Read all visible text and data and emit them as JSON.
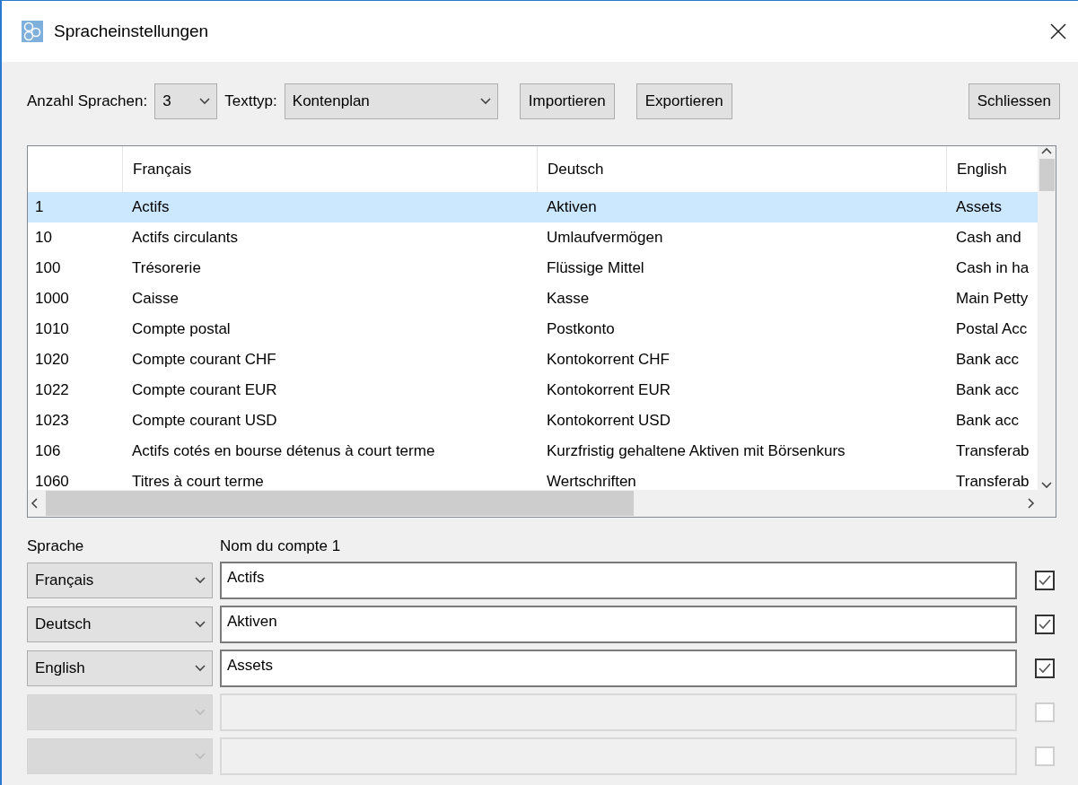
{
  "window": {
    "title": "Spracheinstellungen"
  },
  "toolbar": {
    "count_label": "Anzahl Sprachen:",
    "count_value": "3",
    "type_label": "Texttyp:",
    "type_value": "Kontenplan",
    "buttons": [
      "Importieren",
      "Exportieren"
    ],
    "close_button": "Schliessen"
  },
  "table": {
    "columns": [
      "Français",
      "Deutsch",
      "English"
    ],
    "rows": [
      {
        "number": "1",
        "fr": "Actifs",
        "de": "Aktiven",
        "en": "Assets",
        "selected": true
      },
      {
        "number": "10",
        "fr": "Actifs circulants",
        "de": "Umlaufvermögen",
        "en": "Cash and",
        "selected": false
      },
      {
        "number": "100",
        "fr": "Trésorerie",
        "de": "Flüssige Mittel",
        "en": "Cash in ha",
        "selected": false
      },
      {
        "number": "1000",
        "fr": "Caisse",
        "de": "Kasse",
        "en": "Main Petty",
        "selected": false
      },
      {
        "number": "1010",
        "fr": "Compte postal",
        "de": "Postkonto",
        "en": "Postal Acc",
        "selected": false
      },
      {
        "number": "1020",
        "fr": "Compte courant CHF",
        "de": "Kontokorrent CHF",
        "en": "Bank acc",
        "selected": false
      },
      {
        "number": "1022",
        "fr": "Compte courant EUR",
        "de": "Kontokorrent EUR",
        "en": "Bank acc",
        "selected": false
      },
      {
        "number": "1023",
        "fr": "Compte courant USD",
        "de": "Kontokorrent USD",
        "en": "Bank acc",
        "selected": false
      },
      {
        "number": "106",
        "fr": "Actifs cotés en bourse détenus à court terme",
        "de": "Kurzfristig gehaltene Aktiven mit Börsenkurs",
        "en": "Transferab",
        "selected": false
      },
      {
        "number": "1060",
        "fr": "Titres à court terme",
        "de": "Wertschriften",
        "en": "Transferab",
        "selected": false
      }
    ]
  },
  "editor": {
    "language_label": "Sprache",
    "name_label": "Nom du compte 1",
    "rows": [
      {
        "language": "Français",
        "value": "Actifs",
        "checked": true,
        "disabled": false
      },
      {
        "language": "Deutsch",
        "value": "Aktiven",
        "checked": true,
        "disabled": false
      },
      {
        "language": "English",
        "value": "Assets",
        "checked": true,
        "disabled": false
      },
      {
        "checked": false,
        "disabled": true
      },
      {
        "checked": false,
        "disabled": true
      }
    ]
  }
}
